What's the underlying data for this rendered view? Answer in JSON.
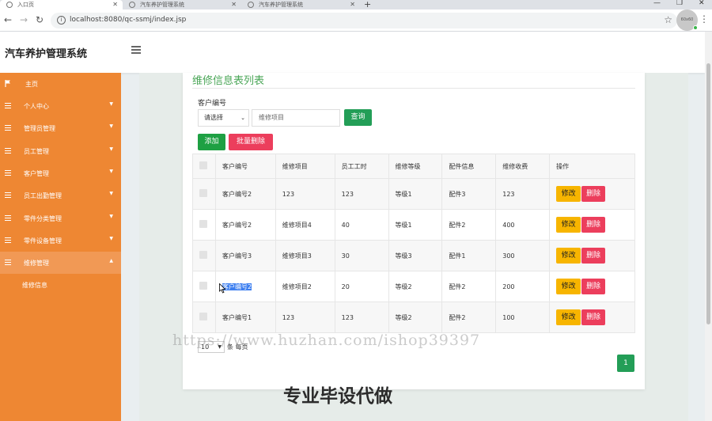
{
  "browser": {
    "tabs": [
      {
        "title": "入口页",
        "active": true
      },
      {
        "title": "汽车养护管理系统",
        "active": false
      },
      {
        "title": "汽车养护管理系统",
        "active": false
      }
    ],
    "url": "localhost:8080/qc-ssmj/index.jsp"
  },
  "header": {
    "title": "汽车养护管理系统",
    "avatar_text": "60x60"
  },
  "sidebar": {
    "home": "主页",
    "items": [
      "个人中心",
      "管理员管理",
      "员工管理",
      "客户管理",
      "员工出勤管理",
      "零件分类管理",
      "零件设备管理",
      "维修管理"
    ],
    "sub_item": "维修信息"
  },
  "main": {
    "title": "维修信息表列表",
    "search_label": "客户编号",
    "select_value": "请选择",
    "input_placeholder": "维修项目",
    "query_btn": "查询",
    "add_btn": "添加",
    "batch_delete_btn": "批量删除",
    "columns": [
      "客户编号",
      "维修项目",
      "员工工时",
      "维修等级",
      "配件信息",
      "维修收费",
      "操作"
    ],
    "rows": [
      [
        "客户编号2",
        "123",
        "123",
        "等级1",
        "配件3",
        "123"
      ],
      [
        "客户编号2",
        "维修项目4",
        "40",
        "等级1",
        "配件2",
        "400"
      ],
      [
        "客户编号3",
        "维修项目3",
        "30",
        "等级3",
        "配件1",
        "300"
      ],
      [
        "客户编号2",
        "维修项目2",
        "20",
        "等级2",
        "配件2",
        "200"
      ],
      [
        "客户编号1",
        "123",
        "123",
        "等级2",
        "配件2",
        "100"
      ]
    ],
    "edit_btn": "修改",
    "delete_btn": "删除",
    "page_size": "10",
    "per_page_label": "条 每页",
    "current_page": "1"
  },
  "overlay": {
    "watermark_url": "https://www.huzhan.com/ishop39397",
    "watermark_text": "专业毕设代做"
  },
  "colors": {
    "sidebar": "#ee8733",
    "accent_green": "#239e57",
    "danger": "#ec3e5c",
    "warning": "#f7b500",
    "title_green": "#4aa657"
  }
}
